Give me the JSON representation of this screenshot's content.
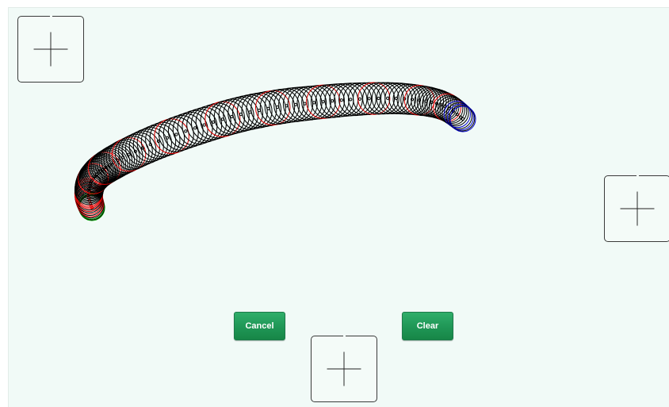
{
  "buttons": {
    "cancel_label": "Cancel",
    "clear_label": "Clear"
  },
  "icons": {
    "target": "crosshair-plus-icon"
  },
  "colors": {
    "canvas_background": "#f1faf7",
    "button_green": "#1f9656",
    "trace_black": "#000000",
    "trace_red": "#e00000",
    "trace_blue": "#0000cc",
    "trace_green": "#00aa00"
  }
}
